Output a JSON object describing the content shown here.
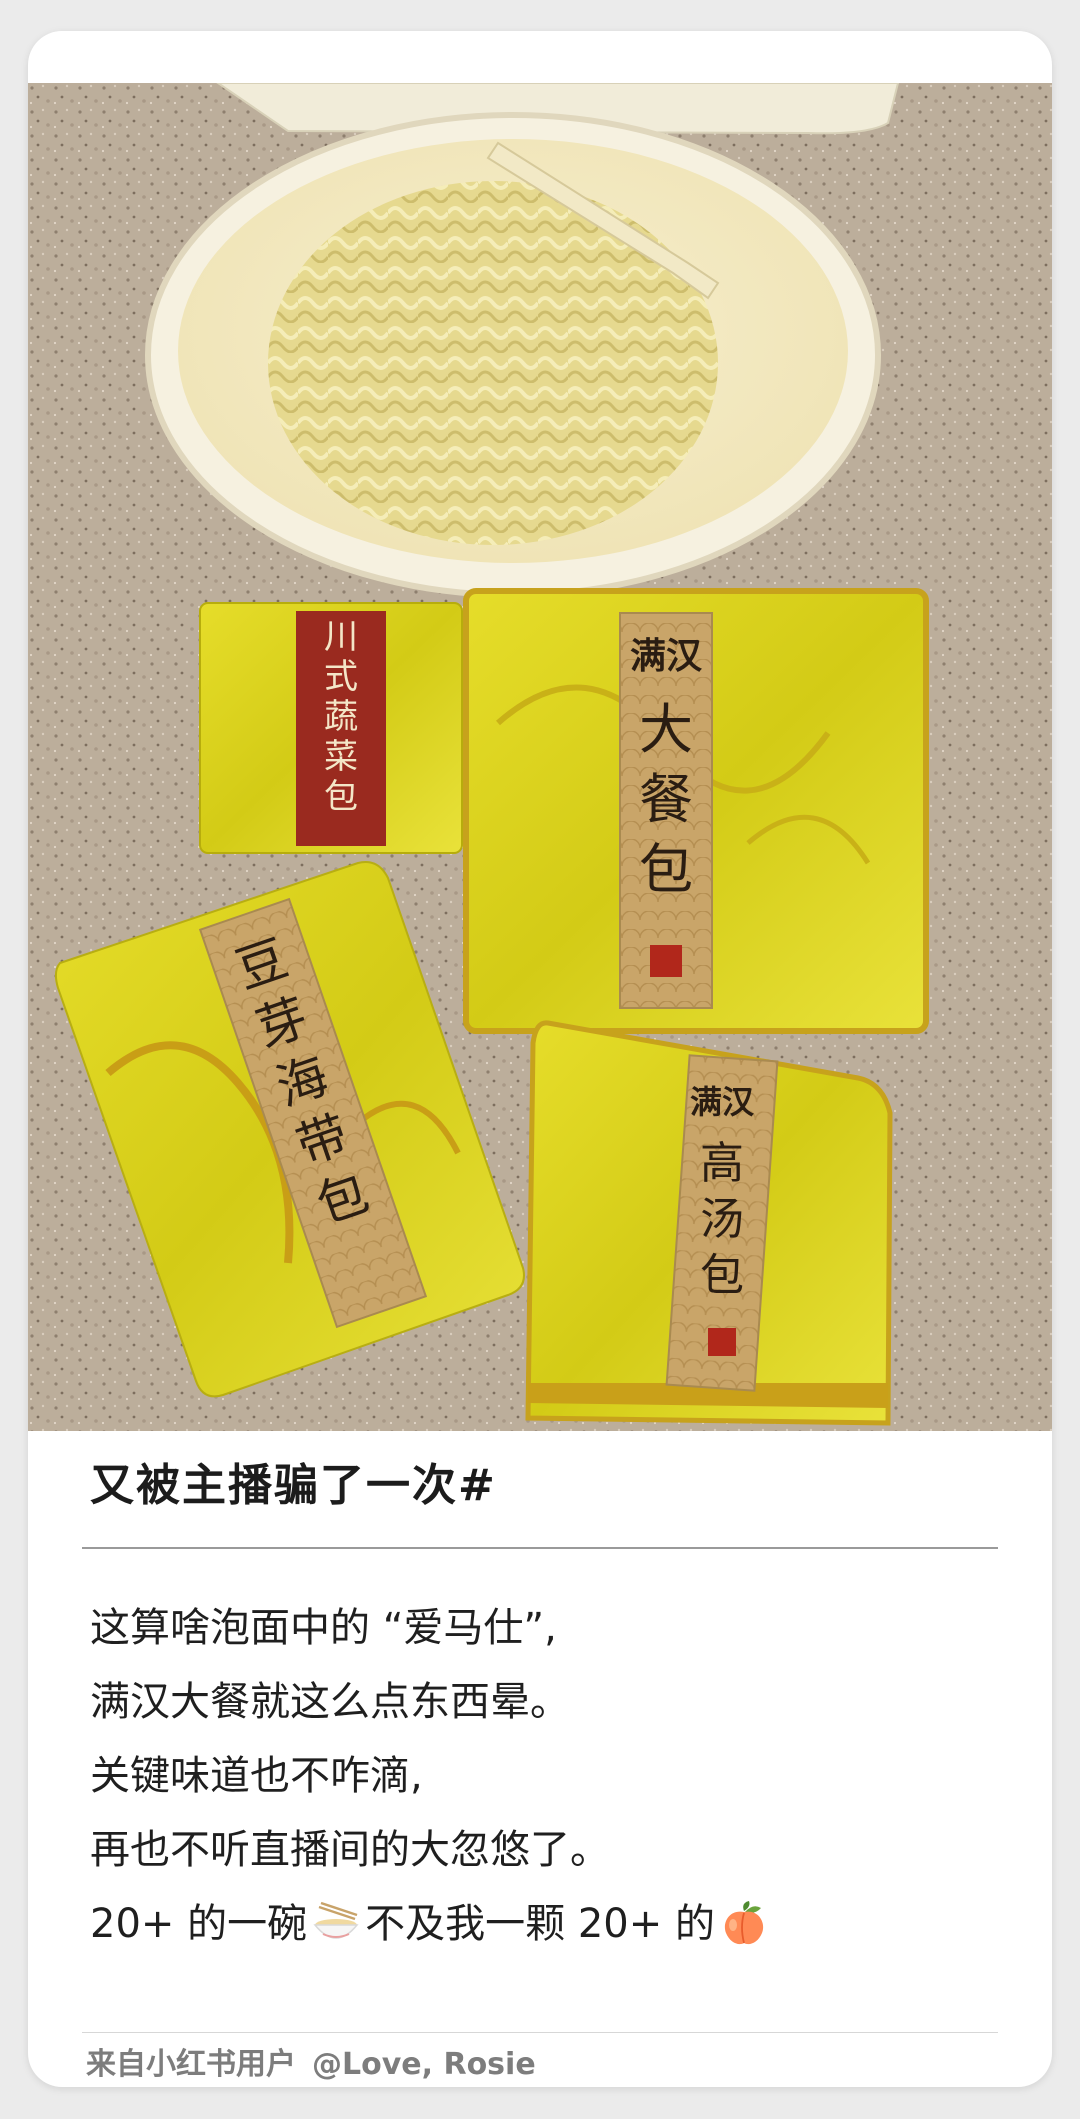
{
  "post": {
    "title": "又被主播骗了一次#",
    "body": {
      "line1": "这算啥泡面中的 “爱马仕”,",
      "line2": "满汉大餐就这么点东西晕。",
      "line3": "关键味道也不咋滴,",
      "line4": "再也不听直播间的大忽悠了。",
      "line5_a": "20+ 的一碗",
      "line5_b": "不及我一颗 20+ 的"
    },
    "icons": {
      "bowl": "noodle-bowl-emoji",
      "peach": "peach-emoji"
    }
  },
  "packets": {
    "veg": "川式蔬菜包",
    "big": "大餐包",
    "bean": "豆芽海带包",
    "soup": "高汤包",
    "brand_mark": "满汉"
  },
  "footer": {
    "source": "来自小红书用户",
    "user": "@Love, Rosie"
  },
  "colors": {
    "packet_yellow": "#dcd21a",
    "label_gold": "#c9a569",
    "label_red": "#9a2a1f",
    "countertop": "#b9aa97"
  }
}
